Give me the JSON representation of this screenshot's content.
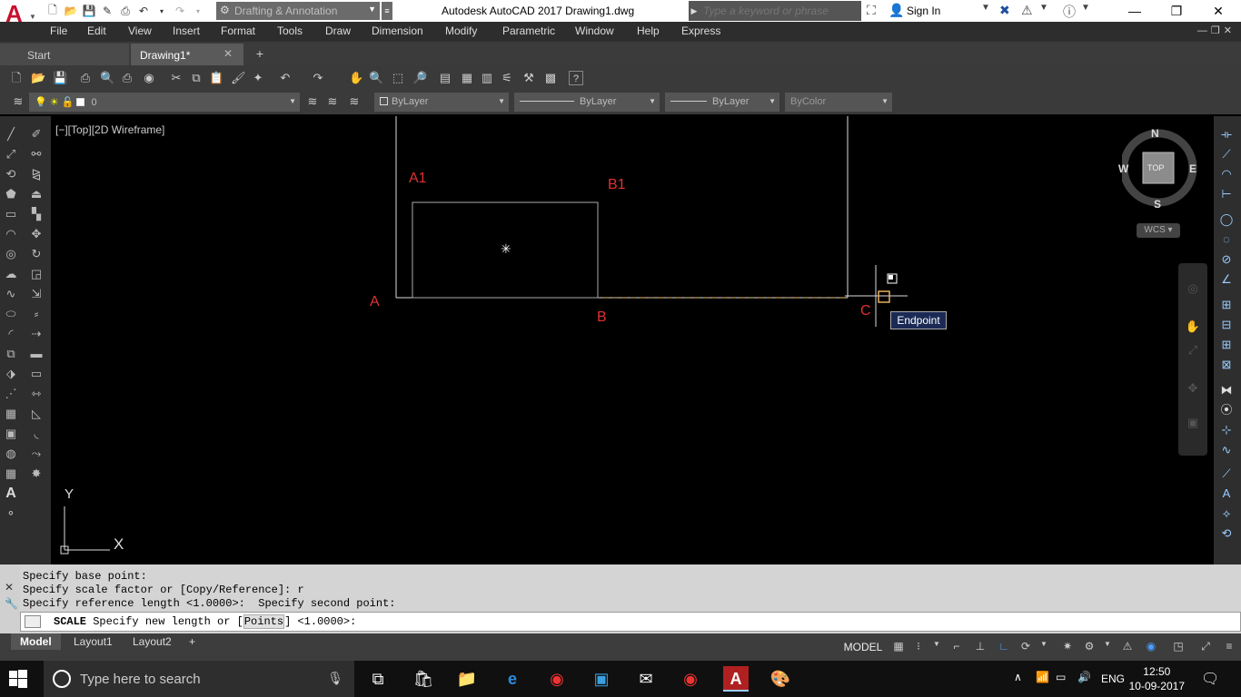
{
  "title_bar": {
    "app_menu_letter": "A",
    "workspace": "Drafting & Annotation",
    "window_title": "Autodesk AutoCAD 2017    Drawing1.dwg",
    "search_placeholder": "Type a keyword or phrase",
    "sign_in": "Sign In"
  },
  "menu": [
    "File",
    "Edit",
    "View",
    "Insert",
    "Format",
    "Tools",
    "Draw",
    "Dimension",
    "Modify",
    "Parametric",
    "Window",
    "Help",
    "Express"
  ],
  "file_tabs": {
    "start": "Start",
    "drawing": "Drawing1*"
  },
  "properties": {
    "layer": "0",
    "color": "ByLayer",
    "linetype": "ByLayer",
    "lineweight": "ByLayer",
    "plotstyle": "ByColor"
  },
  "viewport": {
    "label": "[−][Top][2D Wireframe]",
    "points": {
      "a1": "A1",
      "b1": "B1",
      "a": "A",
      "b": "B",
      "c": "C"
    },
    "snap_tooltip": "Endpoint",
    "ucs": {
      "x": "X",
      "y": "Y"
    }
  },
  "viewcube": {
    "n": "N",
    "s": "S",
    "e": "E",
    "w": "W",
    "top": "TOP",
    "wcs": "WCS"
  },
  "command": {
    "history": [
      "Specify base point:",
      "Specify scale factor or [Copy/Reference]: r",
      "Specify reference length <1.0000>:  Specify second point:"
    ],
    "cmd": "SCALE",
    "prompt_before": " Specify new length or [",
    "prompt_option": "Points",
    "prompt_after": "] <1.0000>:"
  },
  "layout_tabs": [
    "Model",
    "Layout1",
    "Layout2"
  ],
  "status": {
    "model": "MODEL"
  },
  "taskbar": {
    "search_placeholder": "Type here to search",
    "language": "ENG",
    "time": "12:50",
    "date": "10-09-2017"
  },
  "colors": {
    "label_red": "#e03030",
    "accent_red": "#c8102e",
    "tooltip_bg": "#1b2a55"
  }
}
